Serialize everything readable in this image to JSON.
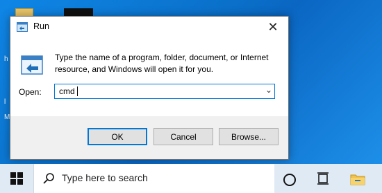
{
  "desktop": {
    "side_labels": [
      "h",
      "l",
      "M"
    ]
  },
  "dialog": {
    "title": "Run",
    "description": "Type the name of a program, folder, document, or Internet resource, and Windows will open it for you.",
    "open_label": "Open:",
    "open_value": "cmd",
    "buttons": {
      "ok": "OK",
      "cancel": "Cancel",
      "browse": "Browse..."
    },
    "close_glyph": "✕"
  },
  "taskbar": {
    "search_placeholder": "Type here to search"
  },
  "icons": [
    "run-icon",
    "close-icon",
    "dropdown-icon",
    "windows-start-icon",
    "search-icon",
    "cortana-icon",
    "task-view-icon",
    "file-explorer-icon"
  ],
  "colors": {
    "accent": "#0078d7",
    "desktop_blue": "#0a6fc8",
    "taskbar": "#dfeaf5"
  }
}
